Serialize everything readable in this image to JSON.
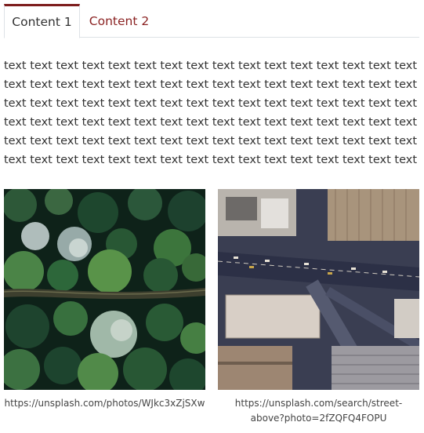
{
  "tabs": [
    {
      "label": "Content 1",
      "active": true
    },
    {
      "label": "Content 2",
      "active": false
    }
  ],
  "content": {
    "lines": [
      "text text text text text text text text text text text text text text text text",
      "text text text text text text text text text text text text text text text text",
      "text text text text text text text text text text text text text text text text",
      "text text text text text text text text text text text text text text text text",
      "text text text text text text text text text text text text text text text text",
      "text text text text text text text text text text text text text text text text"
    ]
  },
  "images": [
    {
      "caption": "https://unsplash.com/photos/WJkc3xZjSXw",
      "subject": "aerial-forest-road"
    },
    {
      "caption_line1": "https://unsplash.com/search/street-",
      "caption_line2": "above?photo=2fZQFQ4FOPU",
      "subject": "aerial-city-street"
    }
  ],
  "colors": {
    "accent": "#7d1d1d",
    "tab_text_inactive": "#8b2323"
  }
}
